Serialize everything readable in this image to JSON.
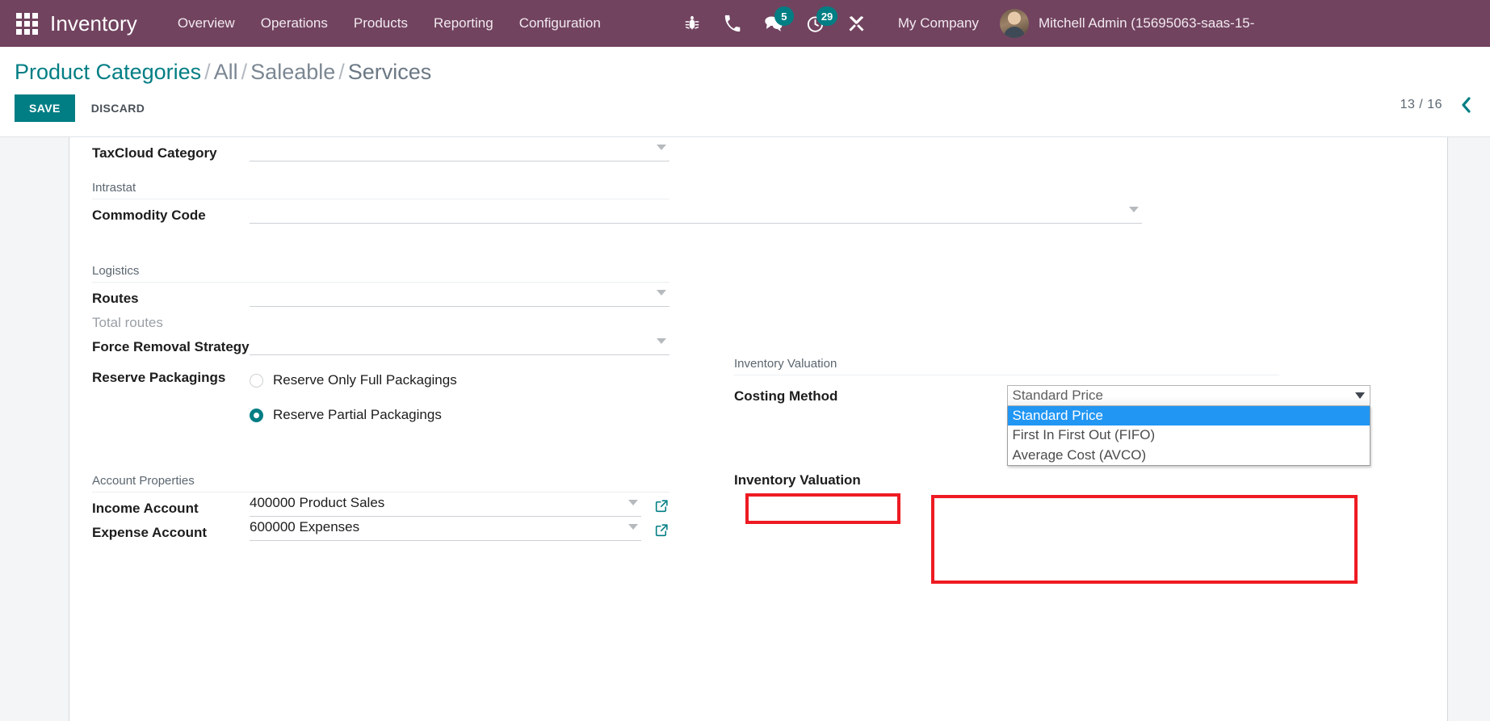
{
  "navbar": {
    "apps_icon": "apps-grid-icon",
    "brand": "Inventory",
    "menu": [
      {
        "label": "Overview"
      },
      {
        "label": "Operations"
      },
      {
        "label": "Products"
      },
      {
        "label": "Reporting"
      },
      {
        "label": "Configuration"
      }
    ],
    "sys_icons": [
      {
        "name": "bug-icon",
        "badge": null
      },
      {
        "name": "phone-icon",
        "badge": null
      },
      {
        "name": "messages-icon",
        "badge": "5"
      },
      {
        "name": "activities-clock-icon",
        "badge": "29"
      },
      {
        "name": "tools-icon",
        "badge": null
      }
    ],
    "company": "My Company",
    "user": "Mitchell Admin (15695063-saas-15-",
    "colors": {
      "background": "#71435f",
      "badge": "#017e84",
      "text": "#f2e9ef"
    }
  },
  "control_panel": {
    "breadcrumb": {
      "root": "Product Categories",
      "separator": "/",
      "items": [
        "All",
        "Saleable",
        "Services"
      ]
    },
    "save_label": "SAVE",
    "discard_label": "DISCARD",
    "pager": {
      "count": "13 / 16",
      "prev_icon": "chevron-left-icon"
    },
    "colors": {
      "accent": "#017e84"
    }
  },
  "form": {
    "left": {
      "taxcloud": {
        "label": "TaxCloud Category",
        "value": ""
      },
      "intrastat_section": "Intrastat",
      "commodity_code": {
        "label": "Commodity Code",
        "value": ""
      },
      "logistics_section": "Logistics",
      "routes": {
        "label": "Routes",
        "value": ""
      },
      "total_routes": {
        "label": "Total routes",
        "value": ""
      },
      "force_removal": {
        "label": "Force Removal Strategy",
        "value": ""
      },
      "reserve_packagings": {
        "label": "Reserve Packagings",
        "options": [
          {
            "label": "Reserve Only Full Packagings",
            "selected": false
          },
          {
            "label": "Reserve Partial Packagings",
            "selected": true
          }
        ]
      },
      "account_section": "Account Properties",
      "income_account": {
        "label": "Income Account",
        "value": "400000 Product Sales"
      },
      "expense_account": {
        "label": "Expense Account",
        "value": "600000 Expenses"
      }
    },
    "right": {
      "valuation_section": "Inventory Valuation",
      "costing_method": {
        "label": "Costing Method",
        "selected": "Standard Price",
        "options": [
          {
            "label": "Standard Price",
            "highlighted": true
          },
          {
            "label": "First In First Out (FIFO)",
            "highlighted": false
          },
          {
            "label": "Average Cost (AVCO)",
            "highlighted": false
          }
        ]
      },
      "inventory_valuation": {
        "label": "Inventory Valuation",
        "value": ""
      }
    }
  },
  "annotations": {
    "highlight_color": "#ee1b22",
    "boxes": [
      {
        "name": "costing-method-label-highlight"
      },
      {
        "name": "costing-method-dropdown-highlight"
      }
    ]
  }
}
